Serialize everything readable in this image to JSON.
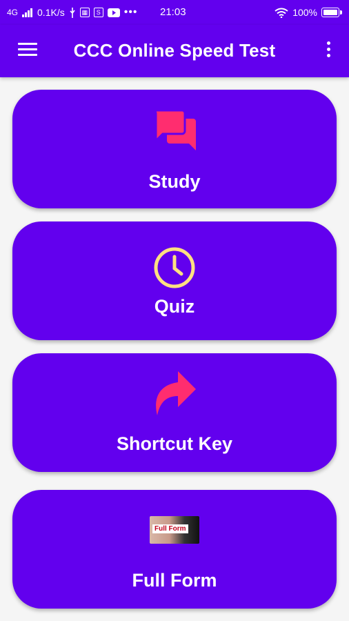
{
  "status_bar": {
    "network": "4G",
    "speed": "0.1K/s",
    "time": "21:03",
    "battery": "100%"
  },
  "app_bar": {
    "title": "CCC Online Speed Test"
  },
  "cards": [
    {
      "label": "Study",
      "icon": "forum-icon",
      "icon_color": "#ff2d6f"
    },
    {
      "label": "Quiz",
      "icon": "clock-icon",
      "icon_color": "#ffe082"
    },
    {
      "label": "Shortcut Key",
      "icon": "share-arrow-icon",
      "icon_color": "#ff2d6f"
    },
    {
      "label": "Full Form",
      "icon": "full-form-image",
      "image_text": "Full Form"
    }
  ],
  "colors": {
    "primary": "#6200ee",
    "background": "#f5f5f5",
    "accent_pink": "#ff2d6f",
    "accent_yellow": "#ffe082"
  }
}
